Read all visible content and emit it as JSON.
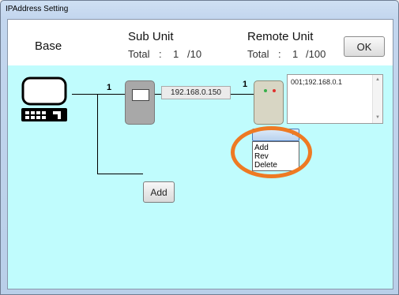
{
  "window": {
    "title": "IPAddress Setting"
  },
  "header": {
    "base_label": "Base",
    "sub_unit": {
      "label": "Sub Unit",
      "total_text": "Total",
      "sep": ":",
      "count": "1",
      "max": "/10"
    },
    "remote_unit": {
      "label": "Remote Unit",
      "total_text": "Total",
      "sep": ":",
      "count": "1",
      "max": "/100"
    },
    "ok_label": "OK"
  },
  "diagram": {
    "base_sub_number": "1",
    "sub_ip": "192.168.0.150",
    "sub_remote_number": "1",
    "remote_list_text": "001;192.168.0.1",
    "add_label": "Add"
  },
  "dropdown": {
    "selected": "",
    "options": [
      "Add",
      "Rev",
      "Delete"
    ]
  },
  "colors": {
    "canvas": "#c0fcfd",
    "highlight": "#ee7a23",
    "led": "#36b04a",
    "led_red": "#e0302d"
  }
}
